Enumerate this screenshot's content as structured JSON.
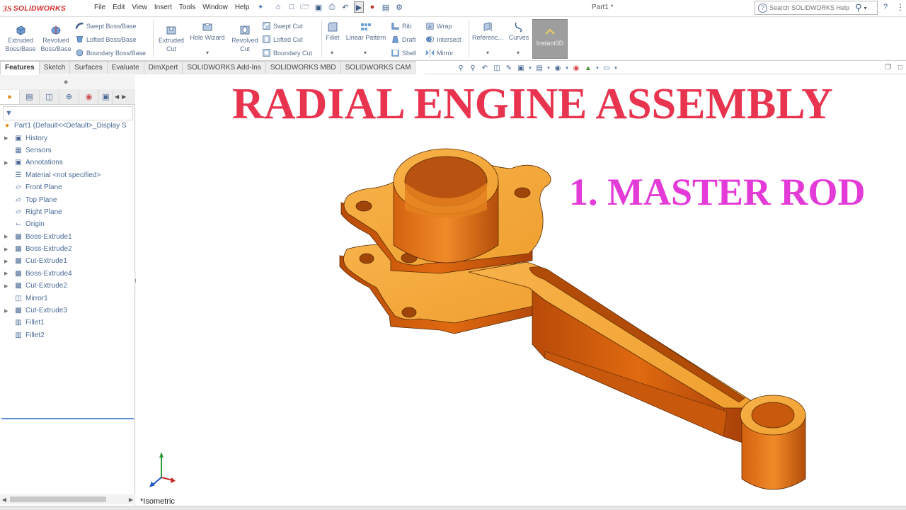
{
  "app": {
    "logo_prefix": "3S",
    "logo_text": "SOLIDWORKS",
    "document_title": "Part1 *"
  },
  "menu": [
    "File",
    "Edit",
    "View",
    "Insert",
    "Tools",
    "Window",
    "Help"
  ],
  "help_search": {
    "placeholder": "Search SOLIDWORKS Help"
  },
  "ribbon": {
    "extruded_boss": "Extruded Boss/Base",
    "revolved_boss": "Revolved Boss/Base",
    "swept_boss": "Swept Boss/Base",
    "lofted_boss": "Lofted Boss/Base",
    "boundary_boss": "Boundary Boss/Base",
    "extruded_cut": "Extruded Cut",
    "hole_wizard": "Hole Wizard",
    "revolved_cut": "Revolved Cut",
    "swept_cut": "Swept Cut",
    "lofted_cut": "Lofted Cut",
    "boundary_cut": "Boundary Cut",
    "fillet": "Fillet",
    "linear_pattern": "Linear Pattern",
    "rib": "Rib",
    "draft": "Draft",
    "shell": "Shell",
    "wrap": "Wrap",
    "intersect": "Intersect",
    "mirror": "Mirror",
    "reference": "Referenc...",
    "curves": "Curves",
    "instant3d": "Instant3D"
  },
  "tabs": [
    "Features",
    "Sketch",
    "Surfaces",
    "Evaluate",
    "DimXpert",
    "SOLIDWORKS Add-Ins",
    "SOLIDWORKS MBD",
    "SOLIDWORKS CAM"
  ],
  "feature_tree": {
    "root": "Part1  (Default<<Default>_Display S",
    "items": [
      {
        "label": "History",
        "icon": "history-folder-icon",
        "expandable": true
      },
      {
        "label": "Sensors",
        "icon": "sensor-icon",
        "expandable": false
      },
      {
        "label": "Annotations",
        "icon": "annotations-icon",
        "expandable": true
      },
      {
        "label": "Material <not specified>",
        "icon": "material-icon",
        "expandable": false
      },
      {
        "label": "Front Plane",
        "icon": "plane-icon",
        "expandable": false
      },
      {
        "label": "Top Plane",
        "icon": "plane-icon",
        "expandable": false
      },
      {
        "label": "Right Plane",
        "icon": "plane-icon",
        "expandable": false
      },
      {
        "label": "Origin",
        "icon": "origin-icon",
        "expandable": false
      },
      {
        "label": "Boss-Extrude1",
        "icon": "boss-extrude-icon",
        "expandable": true
      },
      {
        "label": "Boss-Extrude2",
        "icon": "boss-extrude-icon",
        "expandable": true
      },
      {
        "label": "Cut-Extrude1",
        "icon": "cut-extrude-icon",
        "expandable": true
      },
      {
        "label": "Boss-Extrude4",
        "icon": "boss-extrude-icon",
        "expandable": true
      },
      {
        "label": "Cut-Extrude2",
        "icon": "cut-extrude-icon",
        "expandable": true
      },
      {
        "label": "Mirror1",
        "icon": "mirror-icon",
        "expandable": false
      },
      {
        "label": "Cut-Extrude3",
        "icon": "cut-extrude-icon",
        "expandable": true
      },
      {
        "label": "Fillet1",
        "icon": "fillet-icon",
        "expandable": false
      },
      {
        "label": "Fillet2",
        "icon": "fillet-icon",
        "expandable": false
      }
    ]
  },
  "graphics": {
    "heading": "RADIAL ENGINE ASSEMBLY",
    "subheading": "1. MASTER ROD",
    "view_name": "*Isometric",
    "heading_color": "#e8344f",
    "subheading_color": "#e33ad8",
    "model_color": "#f5a030"
  }
}
